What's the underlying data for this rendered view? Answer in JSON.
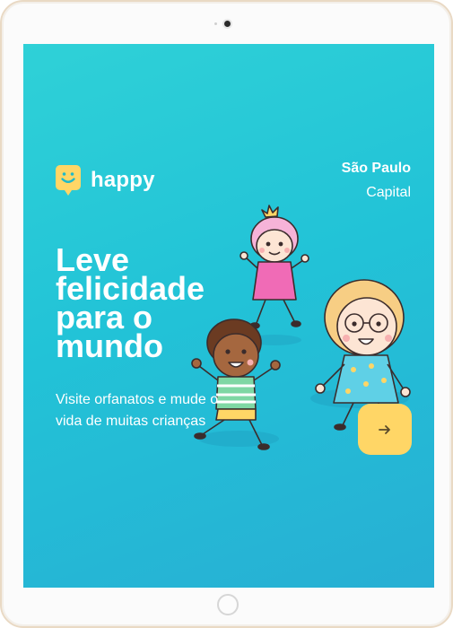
{
  "brand": {
    "name": "happy",
    "logo_icon": "smiley-pin-icon",
    "logo_color": "#FFD666"
  },
  "location": {
    "city": "São Paulo",
    "state": "Capital"
  },
  "hero": {
    "headline_lines": [
      "Leve",
      "felicidade",
      "para o",
      "mundo"
    ],
    "subtitle": "Visite orfanatos e mude o vida de muitas crianças"
  },
  "enter_button": {
    "icon": "arrow-right-icon",
    "color": "#FFD666"
  },
  "illustration": {
    "description_icon": "kids-playing-illustration"
  },
  "colors": {
    "background_start": "#2FD1D7",
    "background_end": "#27AFD4",
    "text": "#FFFFFF"
  }
}
